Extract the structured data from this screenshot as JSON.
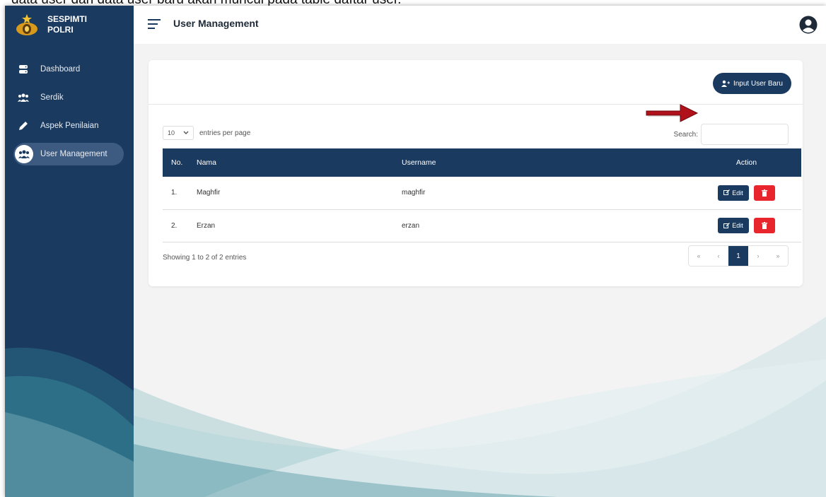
{
  "caption": "data user dan data user baru akan muncul pada table daftar user.",
  "brand": {
    "line1": "SESPIMTI",
    "line2": "POLRI"
  },
  "sidebar": {
    "items": [
      {
        "label": "Dashboard",
        "icon": "database-icon"
      },
      {
        "label": "Serdik",
        "icon": "users-icon"
      },
      {
        "label": "Aspek Penilaian",
        "icon": "pen-icon"
      },
      {
        "label": "User Management",
        "icon": "users-group-icon",
        "active": true
      }
    ]
  },
  "header": {
    "title": "User Management",
    "user_icon": "user-circle-icon"
  },
  "card": {
    "new_button_label": "Input User Baru",
    "entries": {
      "value": "10",
      "suffix": "entries per page"
    },
    "search_label": "Search:",
    "search_value": "",
    "table": {
      "columns": [
        "No.",
        "Nama",
        "Username",
        "Action"
      ],
      "rows": [
        {
          "no": "1.",
          "nama": "Maghfir",
          "username": "maghfir",
          "edit": "Edit"
        },
        {
          "no": "2.",
          "nama": "Erzan",
          "username": "erzan",
          "edit": "Edit"
        }
      ]
    },
    "showing": "Showing 1 to 2 of 2 entries",
    "pagination": {
      "first": "«",
      "prev": "‹",
      "current": "1",
      "next": "›",
      "last": "»"
    }
  },
  "colors": {
    "primary": "#1b3a5f",
    "danger": "#e8242c",
    "annotation_arrow": "#c0141c"
  }
}
